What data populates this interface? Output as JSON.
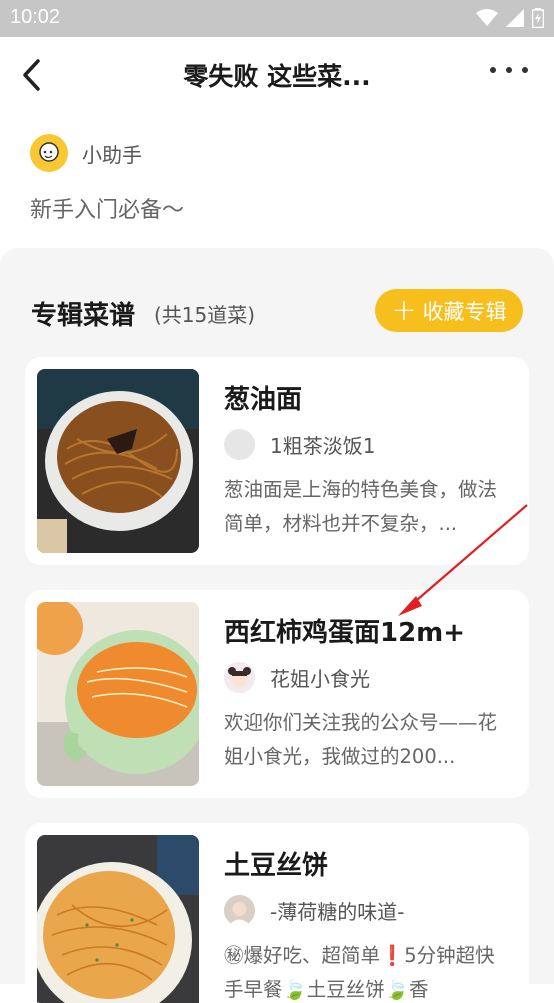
{
  "status": {
    "time": "10:02"
  },
  "header": {
    "title": "零失败 这些菜..."
  },
  "author": {
    "name": "小助手"
  },
  "description": "新手入门必备～",
  "section": {
    "title": "专辑菜谱",
    "count": "(共15道菜)",
    "favorite_label": "收藏专辑"
  },
  "recipes": [
    {
      "title": "葱油面",
      "author": "1粗茶淡饭1",
      "desc": "葱油面是上海的特色美食，做法简单，材料也并不复杂，..."
    },
    {
      "title": "西红柿鸡蛋面12m+",
      "author": "花姐小食光",
      "desc": "欢迎你们关注我的公众号——花姐小食光，我做过的200..."
    },
    {
      "title": "土豆丝饼",
      "author": "-薄荷糖的味道-",
      "desc": "㊙爆好吃、超简单❗5分钟超快手早餐🍃土豆丝饼🍃香"
    }
  ],
  "colors": {
    "accent": "#f7bf1e",
    "annotation": "#e02020"
  }
}
